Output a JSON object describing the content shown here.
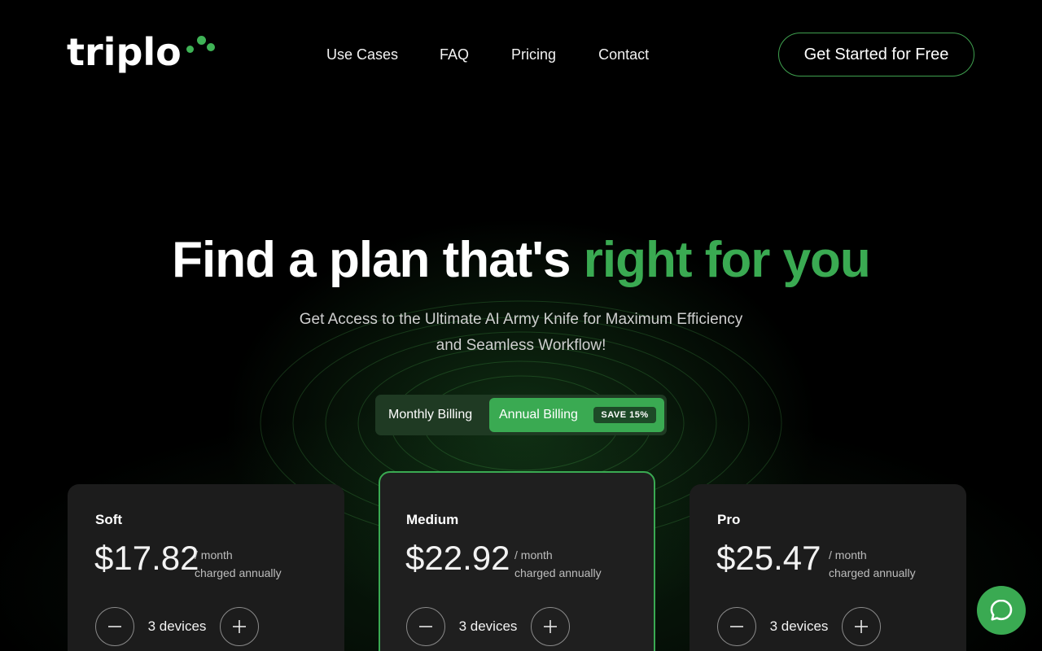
{
  "brand": {
    "logo_text": "triplo",
    "accent": "#3aaa52"
  },
  "nav": {
    "items": [
      {
        "label": "Use Cases"
      },
      {
        "label": "FAQ"
      },
      {
        "label": "Pricing"
      },
      {
        "label": "Contact"
      }
    ],
    "cta_label": "Get Started for Free"
  },
  "hero": {
    "title_main": "Find a plan that's ",
    "title_accent": "right for you",
    "subtitle_line1": "Get Access to the Ultimate AI Army Knife for Maximum Efficiency",
    "subtitle_line2": "and Seamless Workflow!"
  },
  "billing": {
    "monthly_label": "Monthly Billing",
    "annual_label": "Annual Billing",
    "save_badge": "SAVE 15%",
    "selected": "annual"
  },
  "plans": [
    {
      "name": "Soft",
      "price": "$17.82",
      "per_line1": "/ month",
      "per_line2": "charged annually",
      "devices": "3 devices"
    },
    {
      "name": "Medium",
      "price": "$22.92",
      "per_line1": "/ month",
      "per_line2": "charged annually",
      "devices": "3 devices",
      "featured": true
    },
    {
      "name": "Pro",
      "price": "$25.47",
      "per_line1": "/ month",
      "per_line2": "charged annually",
      "devices": "3 devices"
    }
  ],
  "icons": {
    "minus": "minus-icon",
    "plus": "plus-icon",
    "chat": "chat-bubble-icon"
  }
}
